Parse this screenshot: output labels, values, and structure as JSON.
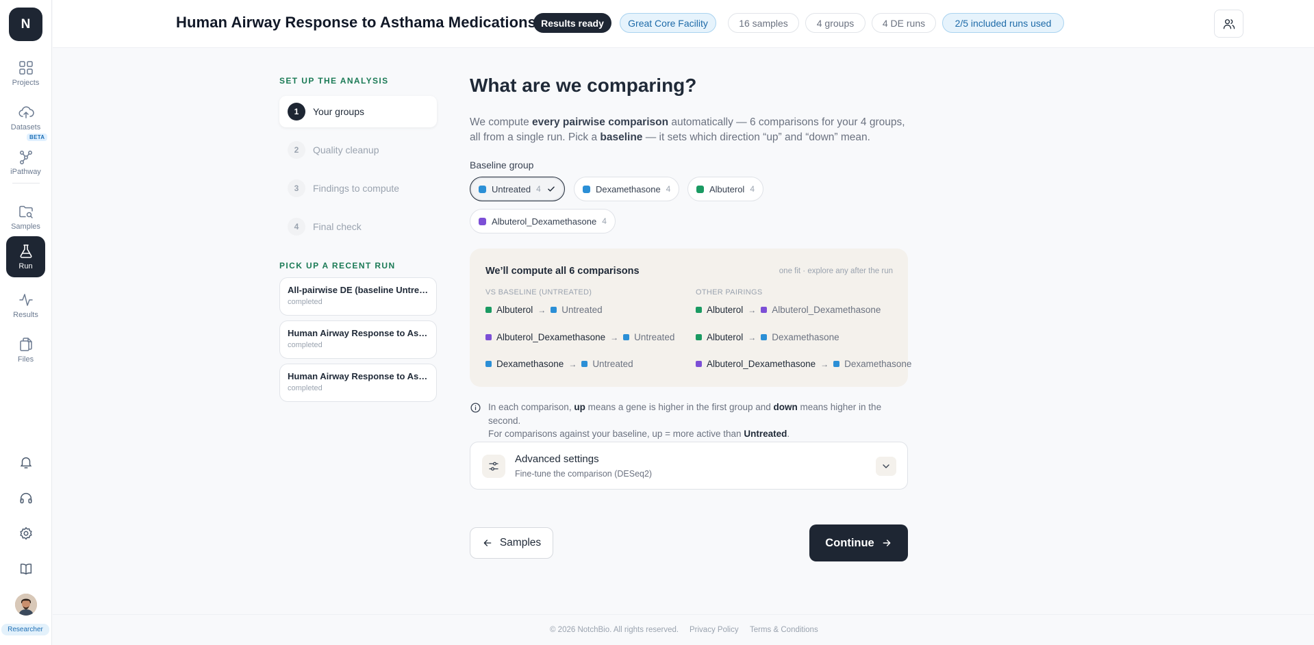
{
  "sidebar": {
    "logo": "N",
    "items": [
      {
        "label": "Projects",
        "icon": "grid-icon"
      },
      {
        "label": "Datasets",
        "icon": "cloud-upload-icon"
      },
      {
        "label": "iPathway",
        "icon": "pathway-icon",
        "badge": "BETA"
      },
      {
        "label": "Samples",
        "icon": "folder-search-icon"
      },
      {
        "label": "Run",
        "icon": "flask-icon",
        "active": true
      },
      {
        "label": "Results",
        "icon": "activity-icon"
      },
      {
        "label": "Files",
        "icon": "files-icon"
      }
    ],
    "role": "Researcher"
  },
  "header": {
    "title": "Human Airway Response to Asthama Medications",
    "status": "Results ready",
    "facility": "Great Core Facility",
    "samples": "16 samples",
    "groups": "4 groups",
    "de_runs": "4 DE runs",
    "runs_used": "2/5 included runs used"
  },
  "setup": {
    "heading": "SET UP THE ANALYSIS",
    "steps": [
      {
        "num": "1",
        "label": "Your groups"
      },
      {
        "num": "2",
        "label": "Quality cleanup"
      },
      {
        "num": "3",
        "label": "Findings to compute"
      },
      {
        "num": "4",
        "label": "Final check"
      }
    ],
    "recent_heading": "PICK UP A RECENT RUN",
    "recent_runs": [
      {
        "title": "All-pairwise DE (baseline Untreated)",
        "status": "completed"
      },
      {
        "title": "Human Airway Response to Asthama Medications",
        "status": "completed"
      },
      {
        "title": "Human Airway Response to Asthama Medications",
        "status": "completed"
      }
    ]
  },
  "main": {
    "title": "What are we comparing?",
    "intro": {
      "p1": "We compute ",
      "b1": "every pairwise comparison",
      "p2": " automatically — 6 comparisons for your 4 groups, all from a single run. Pick a ",
      "b2": "baseline",
      "p3": " — it sets which direction “up” and “down” mean."
    },
    "baseline_label": "Baseline group",
    "groups": [
      {
        "name": "Untreated",
        "count": "4",
        "color": "#2b8fd6",
        "selected": true
      },
      {
        "name": "Dexamethasone",
        "count": "4",
        "color": "#2b8fd6"
      },
      {
        "name": "Albuterol",
        "count": "4",
        "color": "#1a9a62"
      },
      {
        "name": "Albuterol_Dexamethasone",
        "count": "4",
        "color": "#7c4fd6"
      }
    ],
    "comparisons": {
      "title": "We’ll compute all 6 comparisons",
      "note": "one fit · explore any after the run",
      "vs_baseline_header": "VS BASELINE (UNTREATED)",
      "other_header": "OTHER PAIRINGS",
      "vs_baseline": [
        {
          "a": "Albuterol",
          "a_color": "#1a9a62",
          "b": "Untreated",
          "b_color": "#2b8fd6"
        },
        {
          "a": "Albuterol_Dexamethasone",
          "a_color": "#7c4fd6",
          "b": "Untreated",
          "b_color": "#2b8fd6"
        },
        {
          "a": "Dexamethasone",
          "a_color": "#2b8fd6",
          "b": "Untreated",
          "b_color": "#2b8fd6"
        }
      ],
      "other": [
        {
          "a": "Albuterol",
          "a_color": "#1a9a62",
          "b": "Albuterol_Dexamethasone",
          "b_color": "#7c4fd6"
        },
        {
          "a": "Albuterol",
          "a_color": "#1a9a62",
          "b": "Dexamethasone",
          "b_color": "#2b8fd6"
        },
        {
          "a": "Albuterol_Dexamethasone",
          "a_color": "#7c4fd6",
          "b": "Dexamethasone",
          "b_color": "#2b8fd6"
        }
      ]
    },
    "info": {
      "p1": "In each comparison, ",
      "b1": "up",
      "p2": " means a gene is higher in the first group and ",
      "b2": "down",
      "p3": " means higher in the second.",
      "p4": "For comparisons against your baseline, up = more active than ",
      "b3": "Untreated",
      "p5": "."
    },
    "advanced": {
      "title": "Advanced settings",
      "subtitle": "Fine-tune the comparison (DESeq2)"
    },
    "back_label": "Samples",
    "continue_label": "Continue"
  },
  "footer": {
    "copyright": "© 2026 NotchBio. All rights reserved.",
    "privacy": "Privacy Policy",
    "terms": "Terms & Conditions"
  }
}
